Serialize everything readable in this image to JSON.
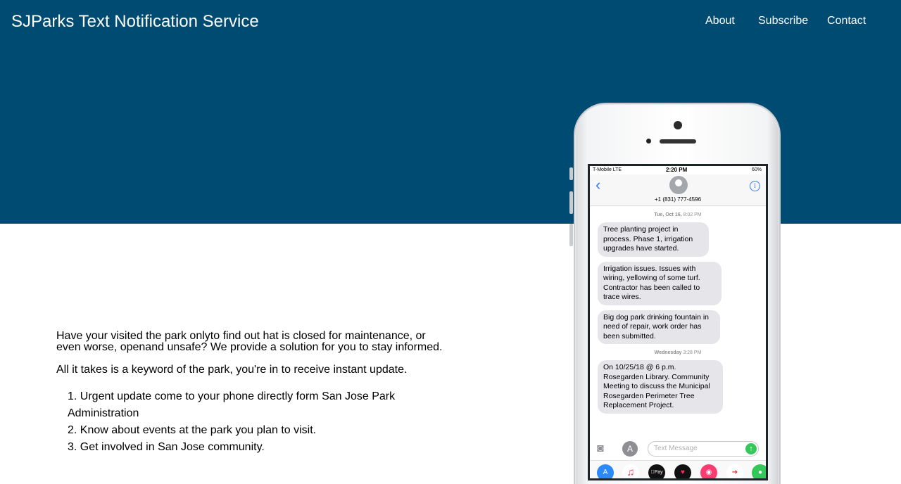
{
  "header": {
    "title": "SJParks Text Notification Service",
    "nav": [
      "About",
      "Subscribe",
      "Contact"
    ]
  },
  "main": {
    "intro": "Have your visited the park onlyto find out hat is closed for maintenance, or even worse, openand unsafe? We provide a solution for you to stay informed.",
    "keyword_text": "All it takes is a keyword of the park, you're in to receive instant update.",
    "benefits": [
      "1. Urgent update come to your phone directly form San Jose Park Administration",
      "2. Know about events at the park you plan to visit.",
      "3. Get involved in San Jose community."
    ]
  },
  "phone": {
    "carrier": "T-Mobile  LTE",
    "time": "2:20 PM",
    "battery": "60%",
    "contact_number": "+1 (831) 777-4596",
    "stamp1_day": "Tue, Oct 16,",
    "stamp1_time": "8:02 PM",
    "messages": [
      "Tree planting project in process. Phase 1, irrigation upgrades have started.",
      "Irrigation issues.  Issues with wiring, yellowing of some turf. Contractor has been called to trace wires.",
      "Big dog park drinking fountain in need of repair, work order has been submitted.",
      "On 10/25/18  @ 6 p.m. Rosegarden Library. Community Meeting to discuss the Municipal Rosegarden Perimeter Tree Replacement Project."
    ],
    "stamp2_day": "Wednesday",
    "stamp2_time": "3:28 PM",
    "input_placeholder": "Text Message",
    "tray_apple_pay": "Pay"
  },
  "colors": {
    "hero": "#004b72",
    "bubble": "#e5e5ea",
    "ios_blue": "#2f7cf6"
  }
}
